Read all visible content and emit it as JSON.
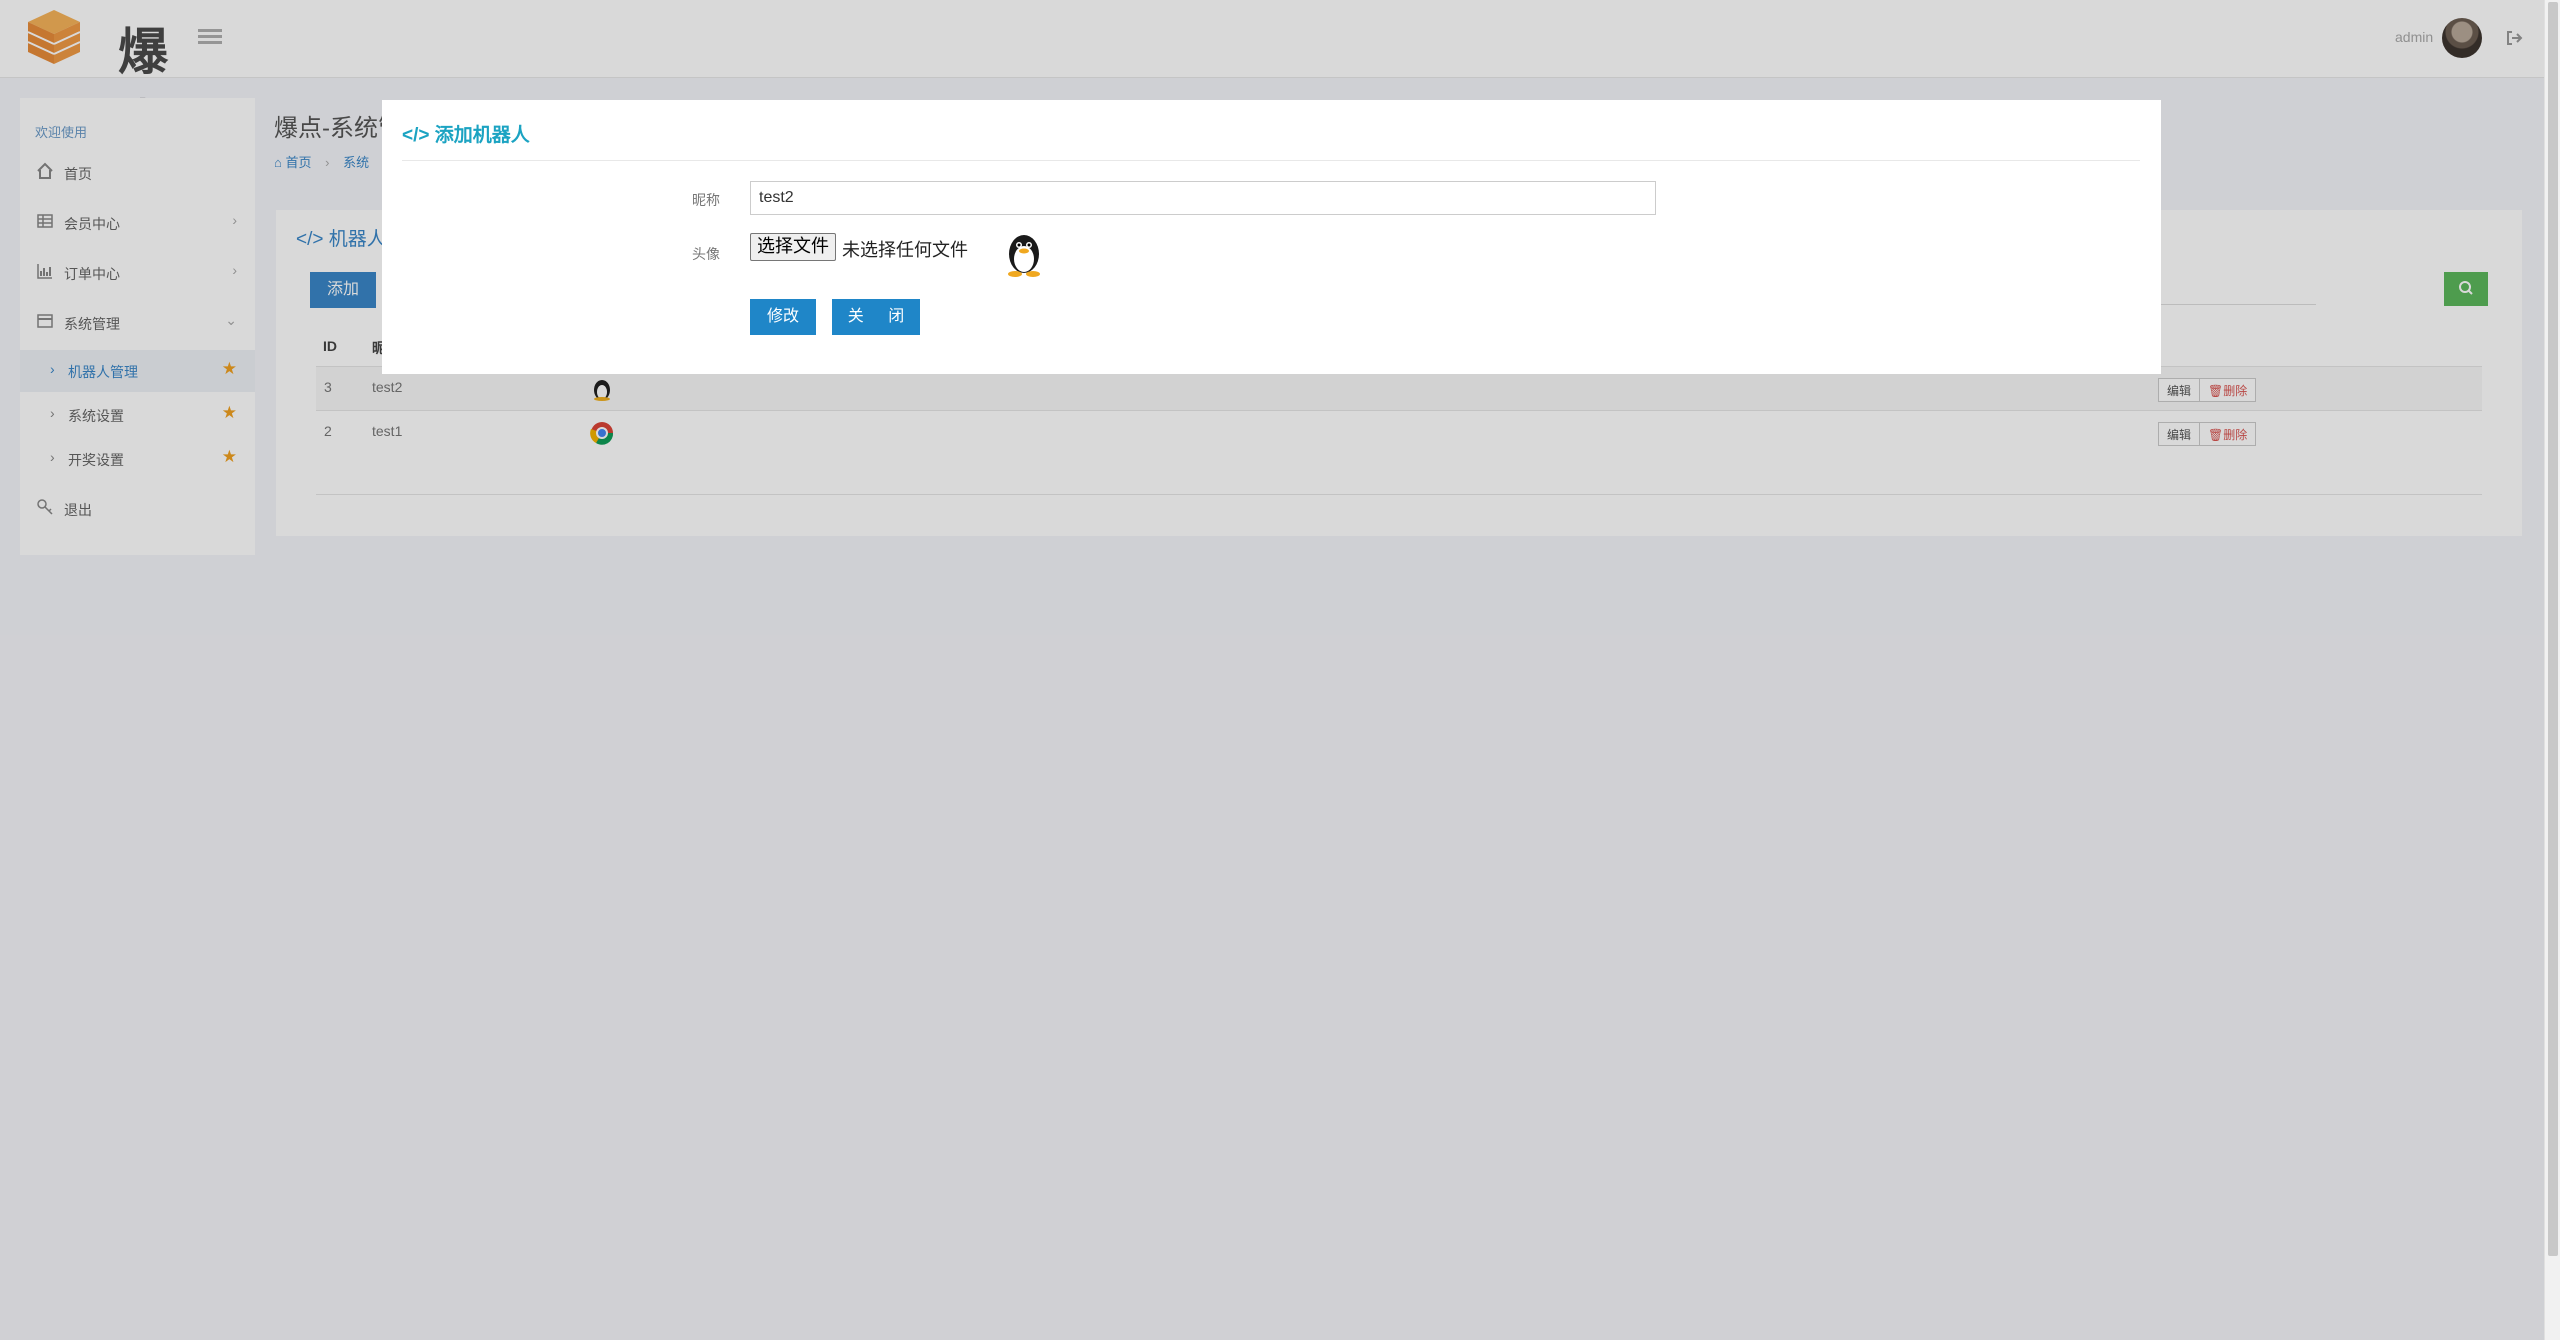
{
  "header": {
    "logo_text": "爆点",
    "admin_name": "admin"
  },
  "sidebar": {
    "welcome": "欢迎使用",
    "items": [
      {
        "label": "首页",
        "icon": "home-icon"
      },
      {
        "label": "会员中心",
        "icon": "table-icon"
      },
      {
        "label": "订单中心",
        "icon": "bar-chart-icon"
      },
      {
        "label": "系统管理",
        "icon": "window-icon"
      }
    ],
    "sub_items": [
      {
        "label": "机器人管理",
        "active": true
      },
      {
        "label": "系统设置",
        "active": false
      },
      {
        "label": "开奖设置",
        "active": false
      }
    ],
    "logout": "退出"
  },
  "main": {
    "page_title": "爆点-系统管",
    "breadcrumb": [
      "首页",
      "系统"
    ],
    "panel_title": "机器人管",
    "add_button": "添加",
    "columns": [
      "ID",
      "昵"
    ],
    "rows": [
      {
        "id": "3",
        "name": "test2",
        "edit": "编辑",
        "delete": "删除"
      },
      {
        "id": "2",
        "name": "test1",
        "edit": "编辑",
        "delete": "删除"
      }
    ]
  },
  "modal": {
    "title": "添加机器人",
    "name_label": "昵称",
    "name_value": "test2",
    "avatar_label": "头像",
    "file_button": "选择文件",
    "file_status": "未选择任何文件",
    "submit_label": "修改",
    "close_label": "关 闭"
  },
  "colors": {
    "accent": "#3a87c8",
    "modal_title": "#1ba3c2",
    "button": "#1f86c8",
    "search": "#5cb85c",
    "star": "#f0a020"
  }
}
